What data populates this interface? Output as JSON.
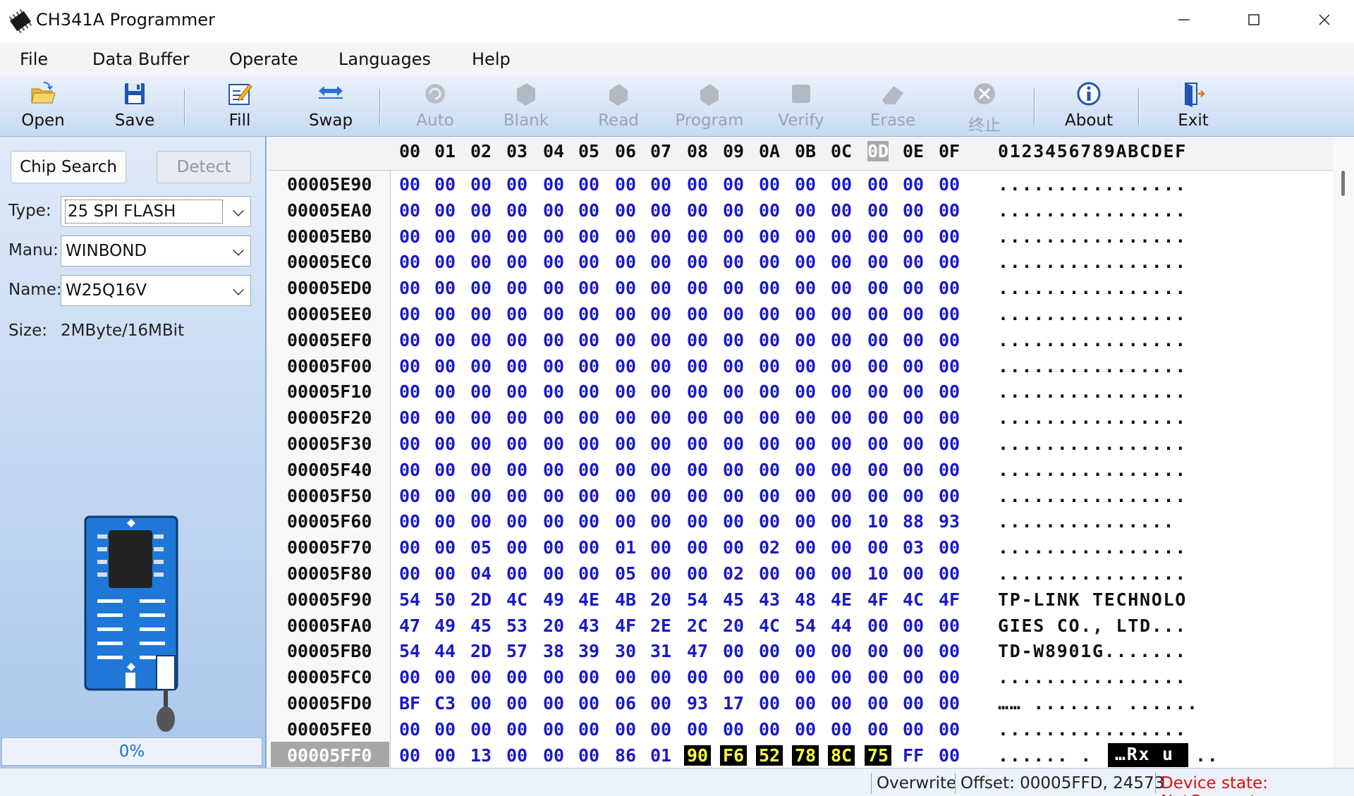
{
  "window": {
    "title": "CH341A Programmer"
  },
  "menu": [
    "File",
    "Data Buffer",
    "Operate",
    "Languages",
    "Help"
  ],
  "toolbar": [
    {
      "label": "Open",
      "icon": "folder-open-icon",
      "enabled": true
    },
    {
      "label": "Save",
      "icon": "floppy-disk-icon",
      "enabled": true
    },
    {
      "label": "Fill",
      "icon": "edit-fill-icon",
      "enabled": true
    },
    {
      "label": "Swap",
      "icon": "swap-arrows-icon",
      "enabled": true
    },
    {
      "label": "Auto",
      "icon": "auto-icon",
      "enabled": false
    },
    {
      "label": "Blank",
      "icon": "blank-check-icon",
      "enabled": false
    },
    {
      "label": "Read",
      "icon": "read-chip-icon",
      "enabled": false
    },
    {
      "label": "Program",
      "icon": "program-chip-icon",
      "enabled": false
    },
    {
      "label": "Verify",
      "icon": "verify-icon",
      "enabled": false
    },
    {
      "label": "Erase",
      "icon": "eraser-icon",
      "enabled": false
    },
    {
      "label": "终止",
      "icon": "stop-icon",
      "enabled": false
    },
    {
      "label": "About",
      "icon": "info-icon",
      "enabled": true
    },
    {
      "label": "Exit",
      "icon": "exit-door-icon",
      "enabled": true
    }
  ],
  "leftpanel": {
    "chip_search": "Chip Search",
    "detect": "Detect",
    "type_label": "Type:",
    "type_value": "25 SPI FLASH",
    "manu_label": "Manu:",
    "manu_value": "WINBOND",
    "name_label": "Name:",
    "name_value": "W25Q16V",
    "size_label": "Size:",
    "size_value": "2MByte/16MBit",
    "progress": "0%"
  },
  "hex": {
    "columns": [
      "00",
      "01",
      "02",
      "03",
      "04",
      "05",
      "06",
      "07",
      "08",
      "09",
      "0A",
      "0B",
      "0C",
      "0D",
      "0E",
      "0F"
    ],
    "ascii_header": "0123456789ABCDEF",
    "cursor_column": 13,
    "rows": [
      {
        "addr": "00005E90",
        "bytes": [
          "00",
          "00",
          "00",
          "00",
          "00",
          "00",
          "00",
          "00",
          "00",
          "00",
          "00",
          "00",
          "00",
          "00",
          "00",
          "00"
        ],
        "ascii": "................"
      },
      {
        "addr": "00005EA0",
        "bytes": [
          "00",
          "00",
          "00",
          "00",
          "00",
          "00",
          "00",
          "00",
          "00",
          "00",
          "00",
          "00",
          "00",
          "00",
          "00",
          "00"
        ],
        "ascii": "................"
      },
      {
        "addr": "00005EB0",
        "bytes": [
          "00",
          "00",
          "00",
          "00",
          "00",
          "00",
          "00",
          "00",
          "00",
          "00",
          "00",
          "00",
          "00",
          "00",
          "00",
          "00"
        ],
        "ascii": "................"
      },
      {
        "addr": "00005EC0",
        "bytes": [
          "00",
          "00",
          "00",
          "00",
          "00",
          "00",
          "00",
          "00",
          "00",
          "00",
          "00",
          "00",
          "00",
          "00",
          "00",
          "00"
        ],
        "ascii": "................"
      },
      {
        "addr": "00005ED0",
        "bytes": [
          "00",
          "00",
          "00",
          "00",
          "00",
          "00",
          "00",
          "00",
          "00",
          "00",
          "00",
          "00",
          "00",
          "00",
          "00",
          "00"
        ],
        "ascii": "................"
      },
      {
        "addr": "00005EE0",
        "bytes": [
          "00",
          "00",
          "00",
          "00",
          "00",
          "00",
          "00",
          "00",
          "00",
          "00",
          "00",
          "00",
          "00",
          "00",
          "00",
          "00"
        ],
        "ascii": "................"
      },
      {
        "addr": "00005EF0",
        "bytes": [
          "00",
          "00",
          "00",
          "00",
          "00",
          "00",
          "00",
          "00",
          "00",
          "00",
          "00",
          "00",
          "00",
          "00",
          "00",
          "00"
        ],
        "ascii": "................"
      },
      {
        "addr": "00005F00",
        "bytes": [
          "00",
          "00",
          "00",
          "00",
          "00",
          "00",
          "00",
          "00",
          "00",
          "00",
          "00",
          "00",
          "00",
          "00",
          "00",
          "00"
        ],
        "ascii": "................"
      },
      {
        "addr": "00005F10",
        "bytes": [
          "00",
          "00",
          "00",
          "00",
          "00",
          "00",
          "00",
          "00",
          "00",
          "00",
          "00",
          "00",
          "00",
          "00",
          "00",
          "00"
        ],
        "ascii": "................"
      },
      {
        "addr": "00005F20",
        "bytes": [
          "00",
          "00",
          "00",
          "00",
          "00",
          "00",
          "00",
          "00",
          "00",
          "00",
          "00",
          "00",
          "00",
          "00",
          "00",
          "00"
        ],
        "ascii": "................"
      },
      {
        "addr": "00005F30",
        "bytes": [
          "00",
          "00",
          "00",
          "00",
          "00",
          "00",
          "00",
          "00",
          "00",
          "00",
          "00",
          "00",
          "00",
          "00",
          "00",
          "00"
        ],
        "ascii": "................"
      },
      {
        "addr": "00005F40",
        "bytes": [
          "00",
          "00",
          "00",
          "00",
          "00",
          "00",
          "00",
          "00",
          "00",
          "00",
          "00",
          "00",
          "00",
          "00",
          "00",
          "00"
        ],
        "ascii": "................"
      },
      {
        "addr": "00005F50",
        "bytes": [
          "00",
          "00",
          "00",
          "00",
          "00",
          "00",
          "00",
          "00",
          "00",
          "00",
          "00",
          "00",
          "00",
          "00",
          "00",
          "00"
        ],
        "ascii": "................"
      },
      {
        "addr": "00005F60",
        "bytes": [
          "00",
          "00",
          "00",
          "00",
          "00",
          "00",
          "00",
          "00",
          "00",
          "00",
          "00",
          "00",
          "00",
          "10",
          "88",
          "93"
        ],
        "ascii": "..............."
      },
      {
        "addr": "00005F70",
        "bytes": [
          "00",
          "00",
          "05",
          "00",
          "00",
          "00",
          "01",
          "00",
          "00",
          "00",
          "02",
          "00",
          "00",
          "00",
          "03",
          "00"
        ],
        "ascii": "................"
      },
      {
        "addr": "00005F80",
        "bytes": [
          "00",
          "00",
          "04",
          "00",
          "00",
          "00",
          "05",
          "00",
          "00",
          "02",
          "00",
          "00",
          "00",
          "10",
          "00",
          "00"
        ],
        "ascii": "................"
      },
      {
        "addr": "00005F90",
        "bytes": [
          "54",
          "50",
          "2D",
          "4C",
          "49",
          "4E",
          "4B",
          "20",
          "54",
          "45",
          "43",
          "48",
          "4E",
          "4F",
          "4C",
          "4F"
        ],
        "ascii": "TP-LINK TECHNOLO"
      },
      {
        "addr": "00005FA0",
        "bytes": [
          "47",
          "49",
          "45",
          "53",
          "20",
          "43",
          "4F",
          "2E",
          "2C",
          "20",
          "4C",
          "54",
          "44",
          "00",
          "00",
          "00"
        ],
        "ascii": "GIES CO., LTD..."
      },
      {
        "addr": "00005FB0",
        "bytes": [
          "54",
          "44",
          "2D",
          "57",
          "38",
          "39",
          "30",
          "31",
          "47",
          "00",
          "00",
          "00",
          "00",
          "00",
          "00",
          "00"
        ],
        "ascii": "TD-W8901G......."
      },
      {
        "addr": "00005FC0",
        "bytes": [
          "00",
          "00",
          "00",
          "00",
          "00",
          "00",
          "00",
          "00",
          "00",
          "00",
          "00",
          "00",
          "00",
          "00",
          "00",
          "00"
        ],
        "ascii": "................"
      },
      {
        "addr": "00005FD0",
        "bytes": [
          "BF",
          "C3",
          "00",
          "00",
          "00",
          "00",
          "06",
          "00",
          "93",
          "17",
          "00",
          "00",
          "00",
          "00",
          "00",
          "00"
        ],
        "ascii": "…… ....... ......"
      },
      {
        "addr": "00005FE0",
        "bytes": [
          "00",
          "00",
          "00",
          "00",
          "00",
          "00",
          "00",
          "00",
          "00",
          "00",
          "00",
          "00",
          "00",
          "00",
          "00",
          "00"
        ],
        "ascii": "................"
      },
      {
        "addr": "00005FF0",
        "bytes": [
          "00",
          "00",
          "13",
          "00",
          "00",
          "00",
          "86",
          "01",
          "90",
          "F6",
          "52",
          "78",
          "8C",
          "75",
          "FF",
          "00"
        ],
        "ascii": "...... .",
        "ascii_selected": "…Rx u",
        "ascii_tail": "..",
        "current": true,
        "selected": [
          8,
          9,
          10,
          11,
          12,
          13
        ]
      }
    ]
  },
  "status": {
    "mode": "Overwrite",
    "offset": "Offset: 00005FFD, 24573",
    "device_state": "Device state: NotConnect",
    "device_state_color": "#e01010"
  }
}
